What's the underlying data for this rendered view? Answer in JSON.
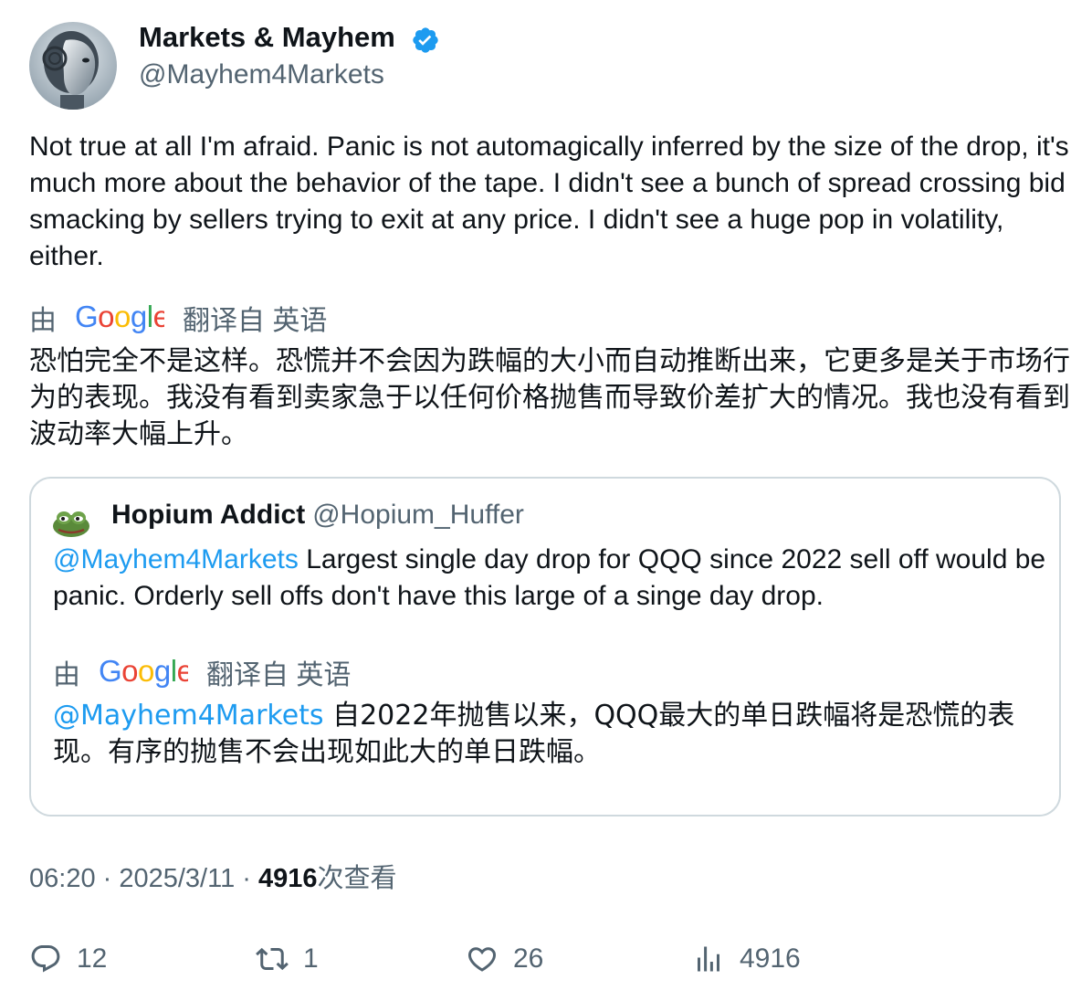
{
  "author": {
    "display_name": "Markets & Mayhem",
    "handle": "@Mayhem4Markets",
    "verified_icon": "verified-badge-icon",
    "badge_color": "#1d9bf0"
  },
  "tweet": {
    "text": "Not true at all I'm afraid. Panic is not automagically inferred by the size of the drop, it's much more about the behavior of the tape. I didn't see a bunch of spread crossing bid smacking by sellers trying to exit at any price. I didn't see a huge pop in volatility, either.",
    "translate_by": "由",
    "google_word": "Google",
    "translate_from": "翻译自 英语",
    "translated_text": "恐怕完全不是这样。恐慌并不会因为跌幅的大小而自动推断出来，它更多是关于市场行为的表现。我没有看到卖家急于以任何价格抛售而导致价差扩大的情况。我也没有看到波动率大幅上升。"
  },
  "quote": {
    "display_name": "Hopium Addict",
    "handle": "@Hopium_Huffer",
    "mention": "@Mayhem4Markets",
    "text": " Largest single day drop for QQQ since 2022 sell off would be panic. Orderly sell offs don't have this large of a singe day drop.",
    "translate_by": "由",
    "google_word": "Google",
    "translate_from": "翻译自 英语",
    "translated_mention": "@Mayhem4Markets",
    "translated_text": " 自2022年抛售以来，QQQ最大的单日跌幅将是恐慌的表现。有序的抛售不会出现如此大的单日跌幅。"
  },
  "meta": {
    "time": "06:20",
    "sep1": " · ",
    "date": "2025/3/11",
    "sep2": " · ",
    "views_count": "4916",
    "views_label": "次查看"
  },
  "actions": {
    "replies": "12",
    "retweets": "1",
    "likes": "26",
    "views": "4916"
  },
  "colors": {
    "text": "#0f1419",
    "secondary": "#536471",
    "link": "#1d9bf0",
    "border": "#cfd9de"
  }
}
